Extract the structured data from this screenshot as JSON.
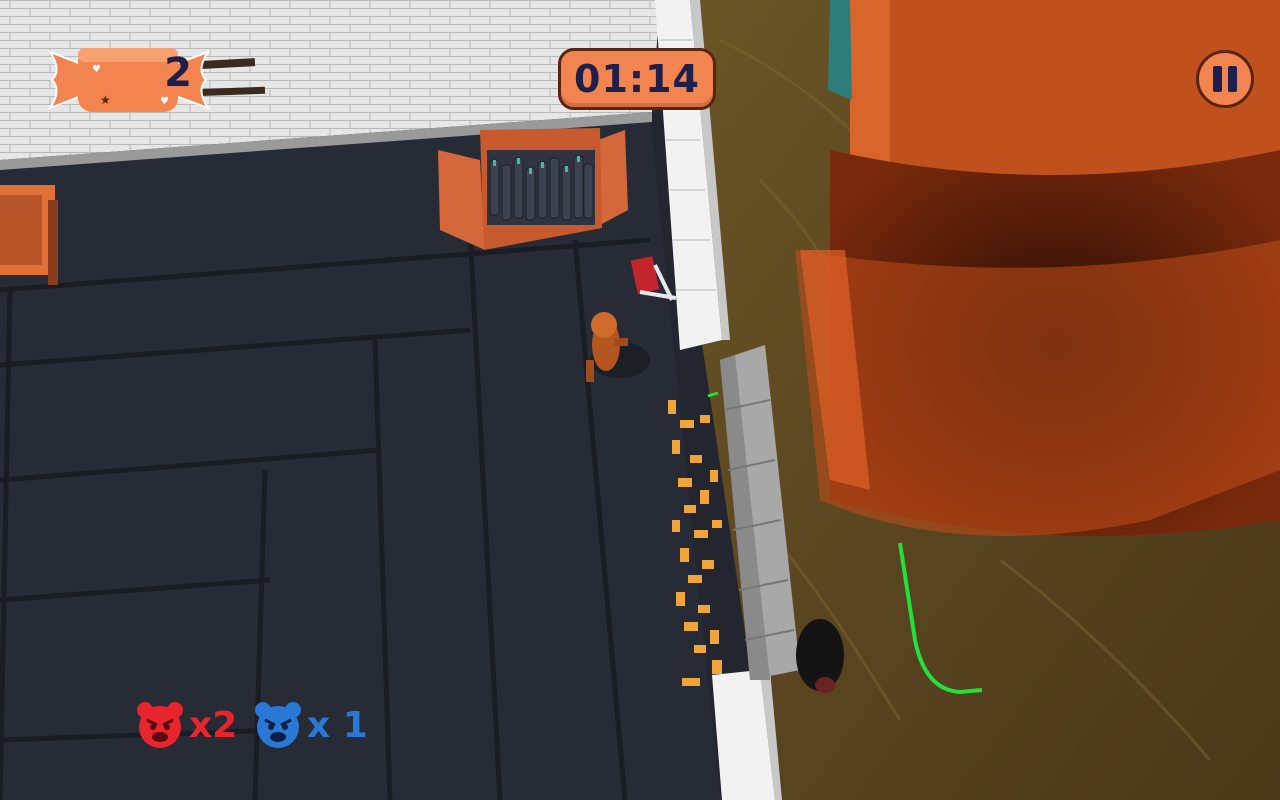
{
  "hud": {
    "candy_count": "2",
    "timer": "01:14"
  },
  "enemies": {
    "red": {
      "count": "x2",
      "color": "#e8242c"
    },
    "blue": {
      "count": "x 1",
      "color": "#2a78d6"
    }
  },
  "icons": {
    "candy": "candy-icon",
    "pause": "pause-icon",
    "red_bear": "red-bear-icon",
    "blue_bear": "blue-bear-icon"
  },
  "colors": {
    "accent": "#f2844f",
    "accent_border": "#5a2412",
    "text_dark": "#1e1f4a",
    "floor": "#262a36",
    "dirt": "#5e4a22",
    "pillar": "#c0501c"
  }
}
